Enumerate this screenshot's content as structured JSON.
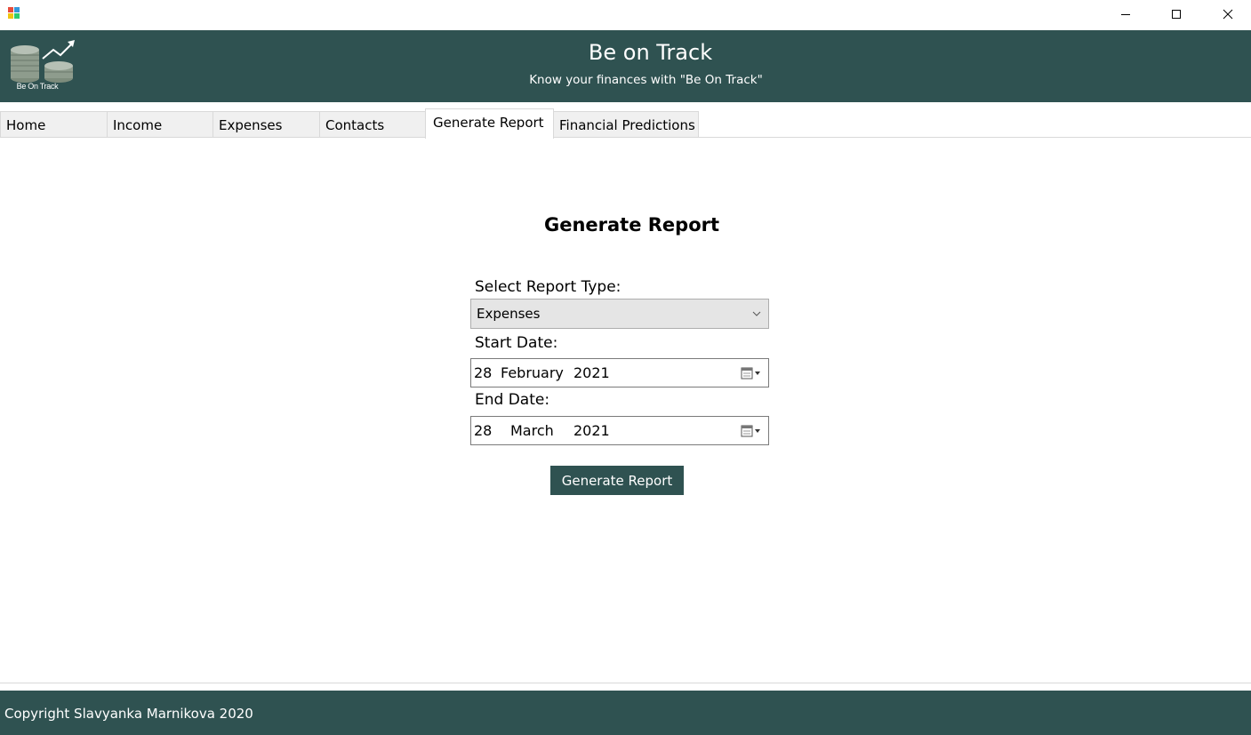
{
  "window": {
    "icons": [
      "app-icon",
      "minimize-icon",
      "maximize-icon",
      "close-icon"
    ]
  },
  "header": {
    "logo_text": "Be On Track",
    "title": "Be on Track",
    "subtitle": "Know your finances with \"Be On Track\""
  },
  "tabs": [
    {
      "label": "Home"
    },
    {
      "label": "Income"
    },
    {
      "label": "Expenses"
    },
    {
      "label": "Contacts"
    },
    {
      "label": "Generate Report",
      "active": true
    },
    {
      "label": "Financial Predictions"
    }
  ],
  "report": {
    "heading": "Generate Report",
    "type_label": "Select Report Type:",
    "type_value": "Expenses",
    "start_label": "Start Date:",
    "start_day": "28",
    "start_month": "February",
    "start_year": "2021",
    "end_label": "End Date:",
    "end_day": "28",
    "end_month": "March",
    "end_year": "2021",
    "button_label": "Generate Report"
  },
  "footer": {
    "copyright": "Copyright Slavyanka Marnikova 2020"
  },
  "colors": {
    "brand": "#2f5251",
    "tab_bg": "#f0f0f0",
    "select_bg": "#e5e5e5"
  }
}
